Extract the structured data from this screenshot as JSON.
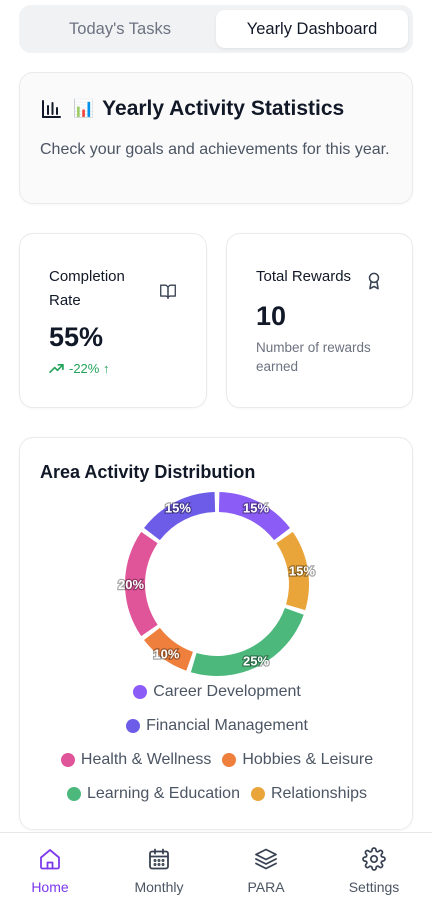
{
  "tabs": [
    {
      "label": "Today's Tasks",
      "active": false
    },
    {
      "label": "Yearly Dashboard",
      "active": true
    }
  ],
  "header": {
    "emoji": "📊",
    "title": "Yearly Activity Statistics",
    "subtitle": "Check your goals and achievements for this year."
  },
  "completion": {
    "label": "Completion Rate",
    "value": "55%",
    "trend": "-22% ↑",
    "icon": "book-open-icon"
  },
  "rewards": {
    "label": "Total Rewards",
    "value": "10",
    "note": "Number of rewards earned",
    "icon": "award-icon"
  },
  "chart": {
    "title": "Area Activity Distribution"
  },
  "chart_data": {
    "type": "pie",
    "title": "Area Activity Distribution",
    "categories": [
      "Career Development",
      "Financial Management",
      "Health & Wellness",
      "Hobbies & Leisure",
      "Learning & Education",
      "Relationships"
    ],
    "values": [
      15,
      15,
      20,
      10,
      25,
      15
    ],
    "colors": [
      "#8b5cf6",
      "#6d5ce8",
      "#e0559a",
      "#ee7f3c",
      "#4cb87c",
      "#e9a53a"
    ],
    "value_labels": [
      "15%",
      "15%",
      "20%",
      "10%",
      "25%",
      "15%"
    ],
    "donut": true,
    "legend_position": "bottom"
  },
  "nav": [
    {
      "label": "Home",
      "icon": "home-icon",
      "active": true
    },
    {
      "label": "Monthly",
      "icon": "calendar-icon",
      "active": false
    },
    {
      "label": "PARA",
      "icon": "layers-icon",
      "active": false
    },
    {
      "label": "Settings",
      "icon": "settings-icon",
      "active": false
    }
  ]
}
